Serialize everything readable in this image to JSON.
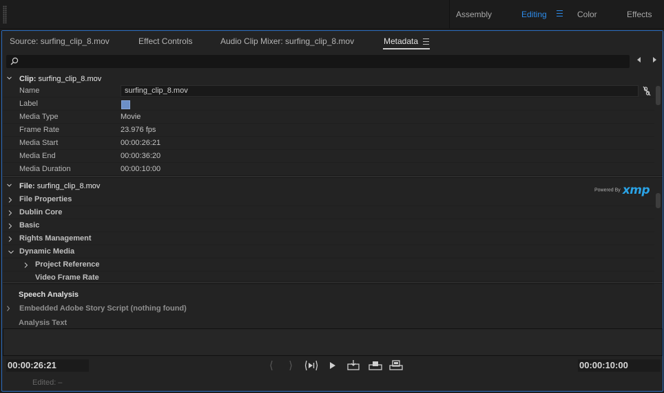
{
  "workspace": {
    "tabs": [
      {
        "label": "Assembly",
        "active": false
      },
      {
        "label": "Editing",
        "active": true
      },
      {
        "label": "Color",
        "active": false
      },
      {
        "label": "Effects",
        "active": false
      }
    ]
  },
  "panel_tabs": [
    {
      "label": "Source: surfing_clip_8.mov",
      "active": false
    },
    {
      "label": "Effect Controls",
      "active": false
    },
    {
      "label": "Audio Clip Mixer: surfing_clip_8.mov",
      "active": false
    },
    {
      "label": "Metadata",
      "active": true
    }
  ],
  "search": {
    "value": "",
    "placeholder": ""
  },
  "clip_section": {
    "heading": "Clip:",
    "file": "surfing_clip_8.mov",
    "expanded": true,
    "name_label": "Name",
    "name_value": "surfing_clip_8.mov",
    "label_label": "Label",
    "label_color": "#6c8fc7",
    "rows": [
      {
        "label": "Media Type",
        "value": "Movie"
      },
      {
        "label": "Frame Rate",
        "value": "23.976 fps"
      },
      {
        "label": "Media Start",
        "value": "00:00:26:21"
      },
      {
        "label": "Media End",
        "value": "00:00:36:20"
      },
      {
        "label": "Media Duration",
        "value": "00:00:10:00"
      }
    ]
  },
  "file_section": {
    "heading": "File:",
    "file": "surfing_clip_8.mov",
    "expanded": true,
    "xmp": {
      "powered": "Powered By",
      "brand": "xmp",
      "color": "#2aa3e6"
    },
    "items": [
      {
        "label": "File Properties",
        "expanded": false,
        "level": 0
      },
      {
        "label": "Dublin Core",
        "expanded": false,
        "level": 0
      },
      {
        "label": "Basic",
        "expanded": false,
        "level": 0
      },
      {
        "label": "Rights Management",
        "expanded": false,
        "level": 0
      },
      {
        "label": "Dynamic Media",
        "expanded": true,
        "level": 0
      },
      {
        "label": "Project Reference",
        "expanded": false,
        "level": 1
      },
      {
        "label": "Video Frame Rate",
        "expanded": false,
        "level": 1
      }
    ]
  },
  "speech_section": {
    "heading": "Speech Analysis",
    "embedded": "Embedded Adobe Story Script (nothing found)",
    "analysis_label": "Analysis Text",
    "analysis_value": ""
  },
  "transport": {
    "current_timecode": "00:00:26:21",
    "duration_timecode": "00:00:10:00",
    "edited": "Edited: –",
    "buttons": [
      "mark-in-icon",
      "mark-out-icon",
      "go-to-in-out-icon",
      "play-icon",
      "insert-icon",
      "overwrite-icon",
      "export-frame-icon"
    ]
  },
  "colors": {
    "accent": "#2d8ceb",
    "panel_border": "#2d6fc2"
  }
}
